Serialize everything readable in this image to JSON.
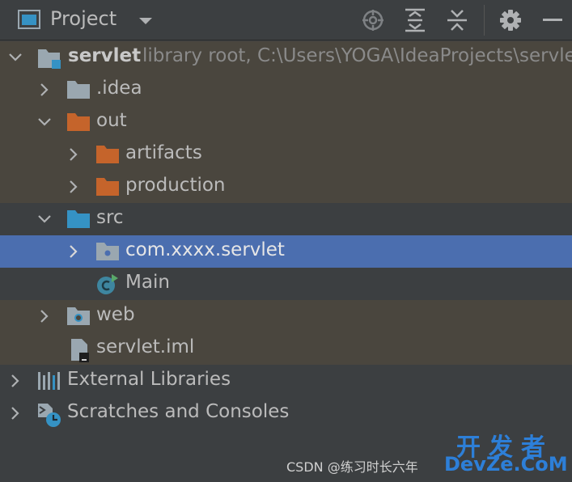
{
  "toolbar": {
    "title": "Project",
    "icons": [
      "project-view-icon",
      "dropdown-caret-icon",
      "locate-icon",
      "expand-all-icon",
      "collapse-all-icon",
      "gear-icon",
      "hide-icon"
    ]
  },
  "tree": {
    "root": {
      "name": "servlet",
      "hint": "library root,  C:\\Users\\YOGA\\IdeaProjects\\servlet"
    },
    "idea": {
      "name": ".idea"
    },
    "out": {
      "name": "out"
    },
    "artifacts": {
      "name": "artifacts"
    },
    "production": {
      "name": "production"
    },
    "src": {
      "name": "src"
    },
    "package": {
      "name": "com.xxxx.servlet"
    },
    "main": {
      "name": "Main"
    },
    "web": {
      "name": "web"
    },
    "iml": {
      "name": "servlet.iml"
    },
    "external": {
      "name": "External Libraries"
    },
    "scratches": {
      "name": "Scratches and Consoles"
    }
  },
  "watermark": {
    "text": "CSDN @练习时长六年",
    "brand": "开发者",
    "domain": "DevZe.CoM"
  },
  "colors": {
    "background": "#3c3f41",
    "library_row": "#4a463e",
    "selection": "#4b6eaf",
    "excluded_folder": "#c5642b",
    "source_folder": "#3592c4",
    "plain_folder": "#9aa7b0"
  }
}
